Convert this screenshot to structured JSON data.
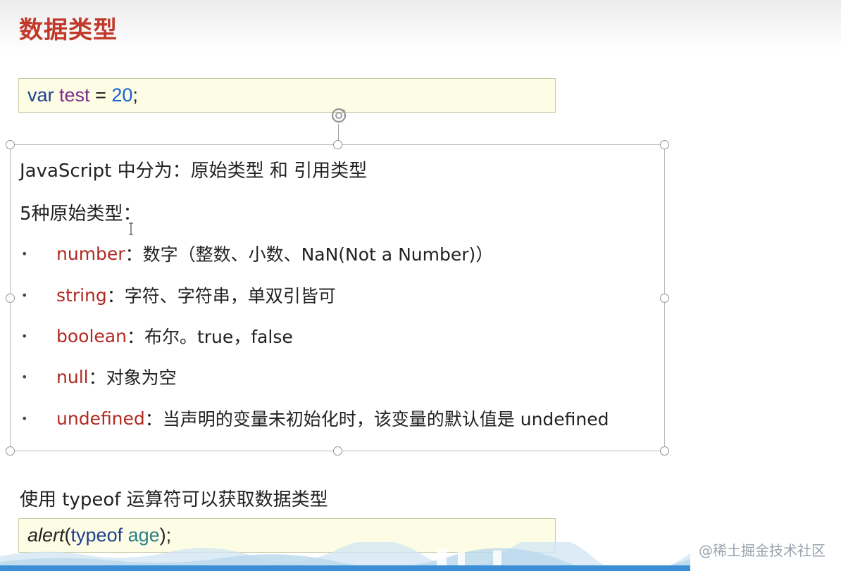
{
  "slide": {
    "title": "数据类型"
  },
  "code_top": {
    "tokens": [
      "var",
      "test",
      "=",
      "20",
      ";"
    ]
  },
  "content": {
    "intro": "JavaScript 中分为：原始类型 和 引用类型",
    "subheading": "5种原始类型：",
    "bullets": [
      {
        "name": "number",
        "desc": "：数字（整数、小数、NaN(Not a Number)）"
      },
      {
        "name": "string",
        "desc": "：字符、字符串，单双引皆可"
      },
      {
        "name": "boolean",
        "desc": "：布尔。true，false"
      },
      {
        "name": "null",
        "desc": "：对象为空"
      },
      {
        "name": "undefined",
        "desc": "：当声明的变量未初始化时，该变量的默认值是 undefined"
      }
    ]
  },
  "bottom": {
    "text": "使用 typeof 运算符可以获取数据类型"
  },
  "code_bottom": {
    "tokens": [
      "alert",
      "(",
      "typeof",
      "age",
      ");"
    ]
  },
  "footer": {
    "watermark": "@稀土掘金技术社区"
  },
  "colors": {
    "title": "#c0392b",
    "type_name": "#b02a22",
    "code_bg": "#fdfde6",
    "footer_bar": "#3a8fd6"
  }
}
